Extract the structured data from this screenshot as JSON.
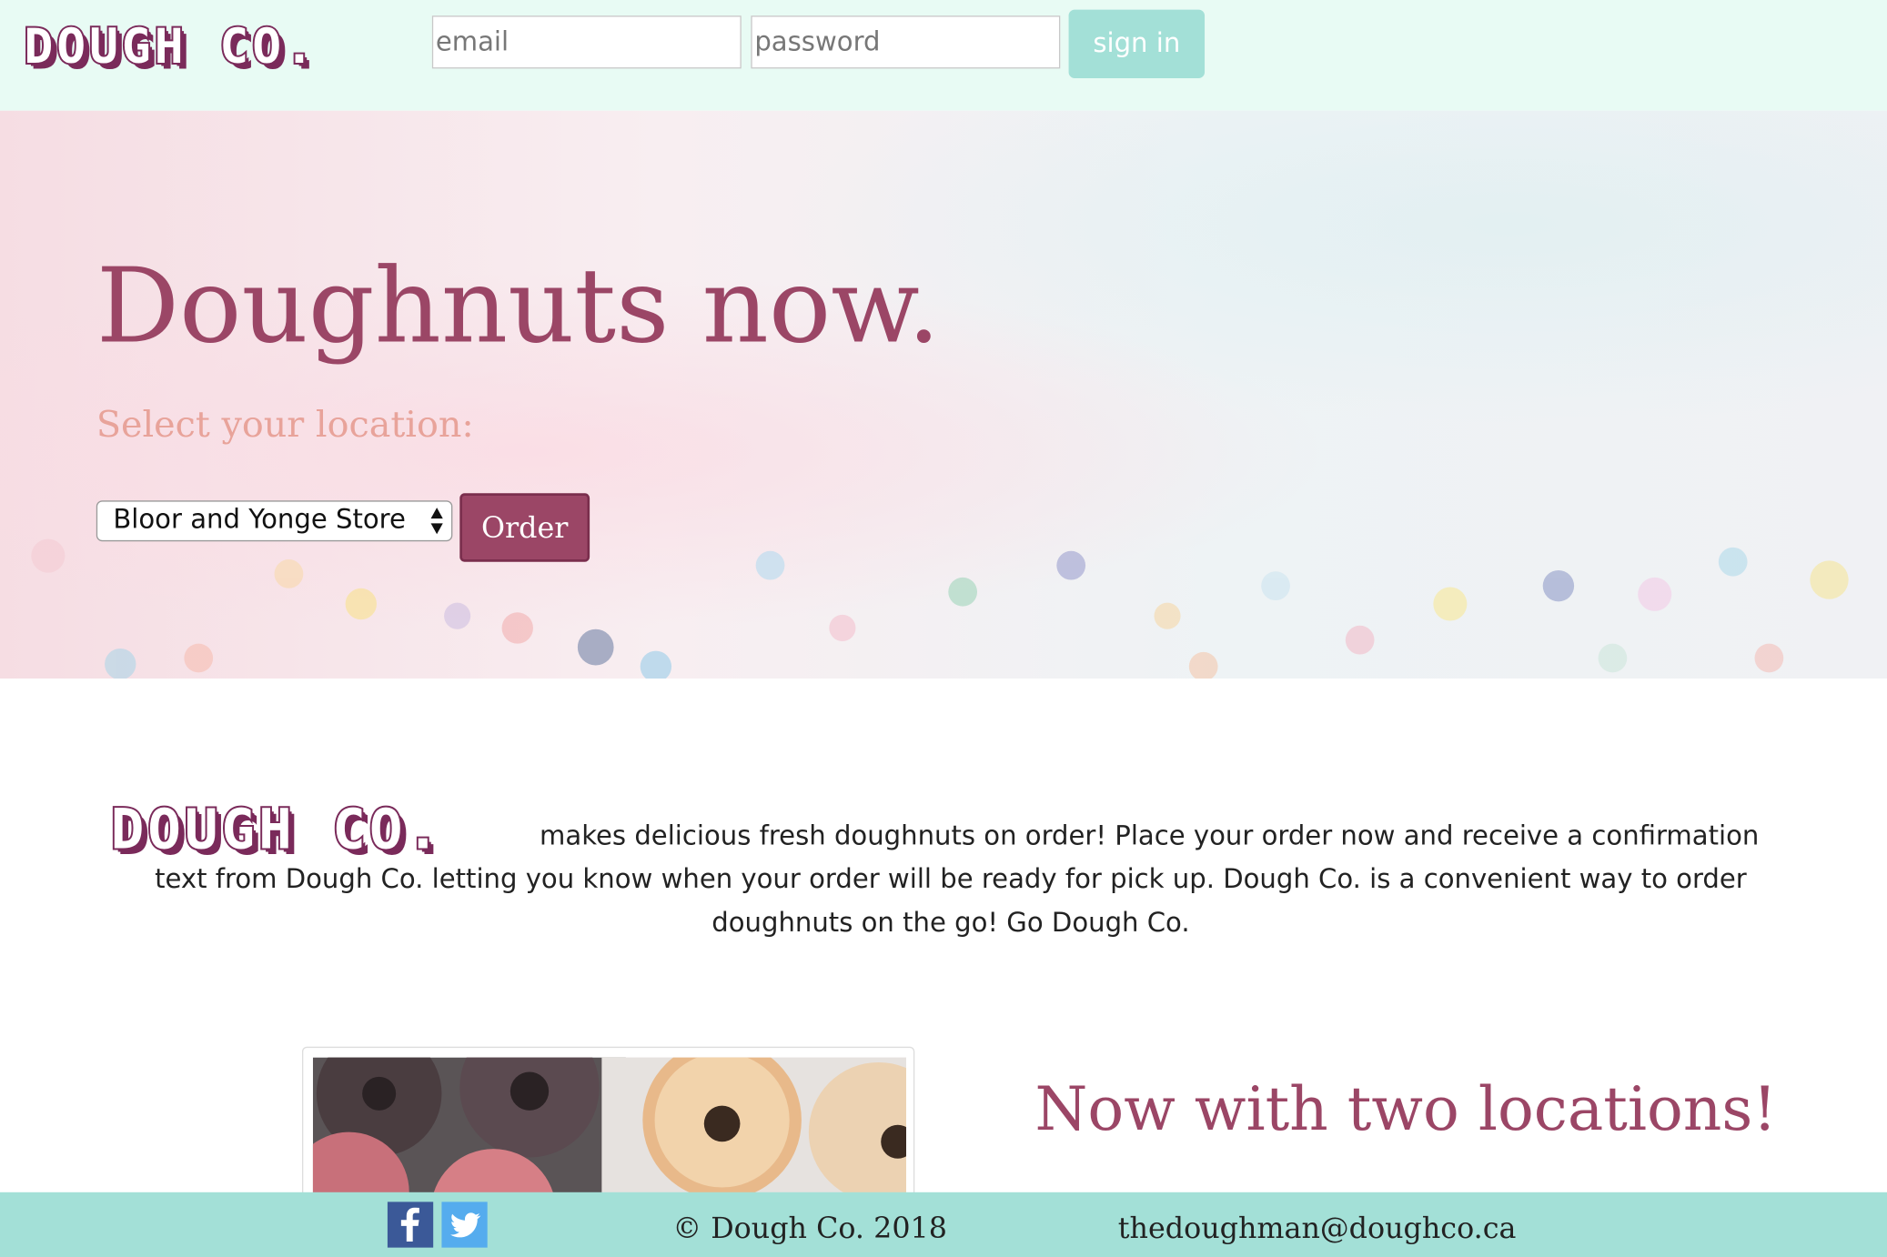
{
  "header": {
    "logo": "DOUGH CO.",
    "email_placeholder": "email",
    "password_placeholder": "password",
    "signin_label": "sign in"
  },
  "hero": {
    "title": "Doughnuts now.",
    "subtitle": "Select your location:",
    "selected_location": "Bloor and Yonge Store",
    "order_label": "Order"
  },
  "about": {
    "logo": "DOUGH CO.",
    "text": "makes delicious fresh doughnuts on order! Place your order now and receive a confirmation text from Dough Co. letting you know when your order will be ready for pick up. Dough Co. is a convenient way to order doughnuts on the go! Go Dough Co."
  },
  "locations": {
    "heading": "Now with two locations!"
  },
  "footer": {
    "social": [
      "facebook-icon",
      "twitter-icon"
    ],
    "copyright": "© Dough Co. 2018",
    "email": "thedoughman@doughco.ca"
  },
  "colors": {
    "header_bg": "#e8fbf4",
    "accent": "#9b4666",
    "teal": "#a3e0d7",
    "subtitle": "#e8a39a",
    "logo": "#7a2a5a"
  }
}
